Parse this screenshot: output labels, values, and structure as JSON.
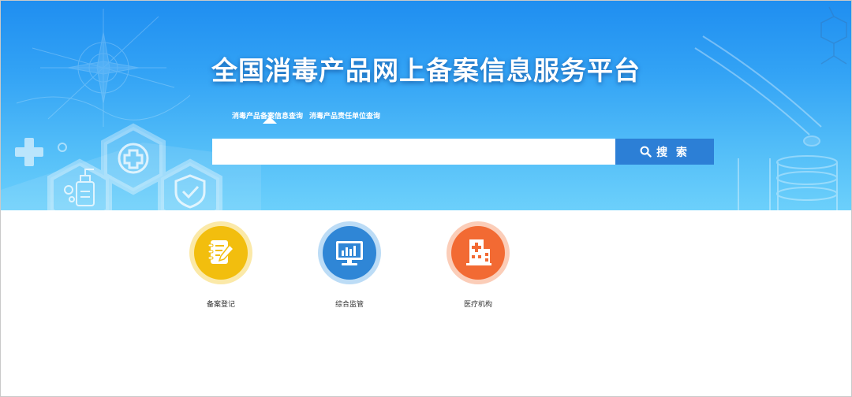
{
  "site": {
    "title": "全国消毒产品网上备案信息服务平台"
  },
  "search": {
    "tabs": [
      {
        "label": "消毒产品备案信息查询",
        "active": true
      },
      {
        "label": "消毒产品责任单位查询",
        "active": false
      }
    ],
    "input_value": "",
    "placeholder": "",
    "button_label": "搜 索",
    "button_icon": "search-icon"
  },
  "services": [
    {
      "label": "备案登记",
      "icon": "register-notebook-icon",
      "color": "#f2be0e",
      "ring_color": "#fbe9a8"
    },
    {
      "label": "综合监管",
      "icon": "monitor-chart-icon",
      "color": "#2f86d6",
      "ring_color": "#bcdcf6"
    },
    {
      "label": "医疗机构",
      "icon": "hospital-building-icon",
      "color": "#f26a33",
      "ring_color": "#fbcdb8"
    }
  ],
  "colors": {
    "banner_top": "#1f8ef0",
    "banner_bottom": "#6cd0fb",
    "search_button": "#2c7fd6"
  }
}
